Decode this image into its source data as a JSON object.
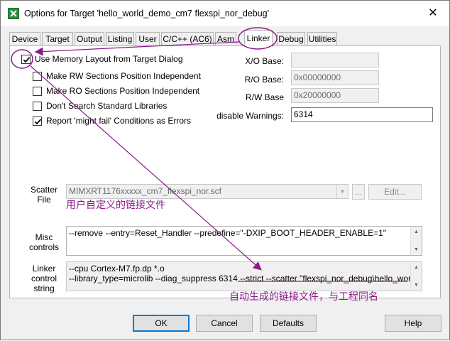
{
  "window": {
    "title": "Options for Target 'hello_world_demo_cm7 flexspi_nor_debug'",
    "close_symbol": "✕"
  },
  "tabs": [
    {
      "label": "Device",
      "active": false
    },
    {
      "label": "Target",
      "active": false
    },
    {
      "label": "Output",
      "active": false
    },
    {
      "label": "Listing",
      "active": false
    },
    {
      "label": "User",
      "active": false
    },
    {
      "label": "C/C++ (AC6)",
      "active": false
    },
    {
      "label": "Asm",
      "active": false
    },
    {
      "label": "Linker",
      "active": true
    },
    {
      "label": "Debug",
      "active": false
    },
    {
      "label": "Utilities",
      "active": false
    }
  ],
  "options": [
    {
      "label": "Use Memory Layout from Target Dialog",
      "checked": true
    },
    {
      "label": "Make RW Sections Position Independent",
      "checked": false
    },
    {
      "label": "Make RO Sections Position Independent",
      "checked": false
    },
    {
      "label": "Don't Search Standard Libraries",
      "checked": false
    },
    {
      "label": "Report 'might fail' Conditions as Errors",
      "checked": true
    }
  ],
  "bases": {
    "xo_label": "X/O Base:",
    "xo_value": "",
    "ro_label": "R/O Base:",
    "ro_value": "0x00000000",
    "rw_label": "R/W Base",
    "rw_value": "0x20000000"
  },
  "warnings": {
    "label": "disable Warnings:",
    "value": "6314"
  },
  "scatter": {
    "label_line1": "Scatter",
    "label_line2": "File",
    "value": "MIMXRT1176xxxxx_cm7_flexspi_nor.scf",
    "browse_label": "...",
    "edit_label": "Edit..."
  },
  "misc": {
    "label_line1": "Misc",
    "label_line2": "controls",
    "value": "--remove --entry=Reset_Handler --predefine=\"-DXIP_BOOT_HEADER_ENABLE=1\""
  },
  "linker_control": {
    "label_line1": "Linker",
    "label_line2": "control",
    "label_line3": "string",
    "line1": "--cpu Cortex-M7.fp.dp *.o",
    "line2": "--library_type=microlib --diag_suppress 6314 --strict --scatter \"flexspi_nor_debug\\hello_world_demo_cm"
  },
  "annotations": {
    "scatter_note": "用户自定义的链接文件",
    "generated_note": "自动生成的链接文件，与工程同名"
  },
  "buttons": {
    "ok": "OK",
    "cancel": "Cancel",
    "defaults": "Defaults",
    "help": "Help"
  },
  "colors": {
    "annotation": "#8a1b8a",
    "default_button_border": "#0078d7"
  }
}
